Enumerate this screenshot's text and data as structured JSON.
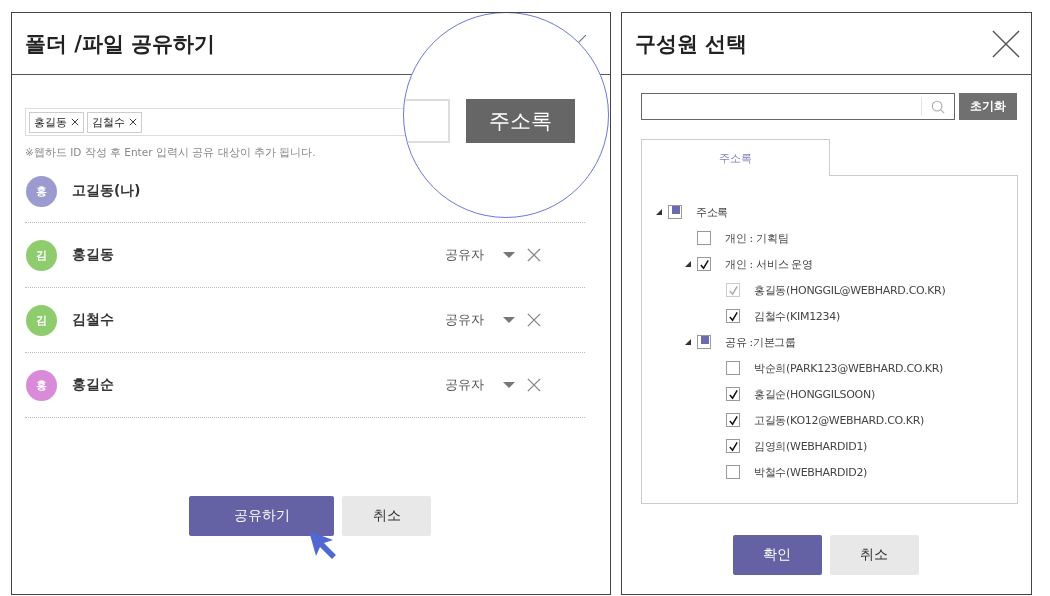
{
  "share_dialog": {
    "title": "폴더 /파일 공유하기",
    "tags": [
      {
        "label": "홍길동"
      },
      {
        "label": "김철수"
      }
    ],
    "hint": "※웹하드 ID 작성 후 Enter 입력시 공유 대상이 추가 됩니다.",
    "magnifier": {
      "button": "주소록"
    },
    "members": [
      {
        "initial": "홍",
        "name": "고길동(나)",
        "color": "#9b9bd0"
      },
      {
        "initial": "김",
        "name": "홍길동",
        "color": "#8fcc6e",
        "role": "공유자"
      },
      {
        "initial": "김",
        "name": "김철수",
        "color": "#8fcc6e",
        "role": "공유자"
      },
      {
        "initial": "홍",
        "name": "홍길순",
        "color": "#d98ad8",
        "role": "공유자"
      }
    ],
    "buttons": [
      {
        "kind": "primary",
        "label": "공유하기"
      },
      {
        "kind": "secondary",
        "label": "취소"
      }
    ]
  },
  "member_dialog": {
    "title": "구성원 선택",
    "reset_button": "초기화",
    "tabs": [
      {
        "label": "주소록",
        "selected": true
      }
    ],
    "tree": [
      {
        "label": "주소록",
        "checked": false,
        "partial": true,
        "disabled": false,
        "expanded": true,
        "children": [
          {
            "label": "개인 : 기획팀",
            "checked": false,
            "partial": false,
            "disabled": false
          },
          {
            "label": "개인 : 서비스 운영",
            "checked": true,
            "partial": false,
            "disabled": false,
            "expanded": true,
            "children": [
              {
                "label": "홍길동(HONGGIL@WEBHARD.CO.KR)",
                "checked": true,
                "partial": false,
                "disabled": true
              },
              {
                "label": "김철수(KIM1234)",
                "checked": true,
                "partial": false,
                "disabled": false
              }
            ]
          },
          {
            "label": "공유 :기본그룹",
            "checked": false,
            "partial": true,
            "disabled": false,
            "expanded": true,
            "children": [
              {
                "label": "박순희(PARK123@WEBHARD.CO.KR)",
                "checked": false,
                "partial": false,
                "disabled": false
              },
              {
                "label": "홍길순(HONGGILSOON)",
                "checked": true,
                "partial": false,
                "disabled": false
              },
              {
                "label": "고길동(KO12@WEBHARD.CO.KR)",
                "checked": true,
                "partial": false,
                "disabled": false
              },
              {
                "label": "김영희(WEBHARDID1)",
                "checked": true,
                "partial": false,
                "disabled": false
              },
              {
                "label": "박철수(WEBHARDID2)",
                "checked": false,
                "partial": false,
                "disabled": false
              }
            ]
          }
        ]
      }
    ],
    "buttons": [
      {
        "kind": "primary",
        "label": "확인"
      },
      {
        "kind": "secondary",
        "label": "취소"
      }
    ]
  }
}
